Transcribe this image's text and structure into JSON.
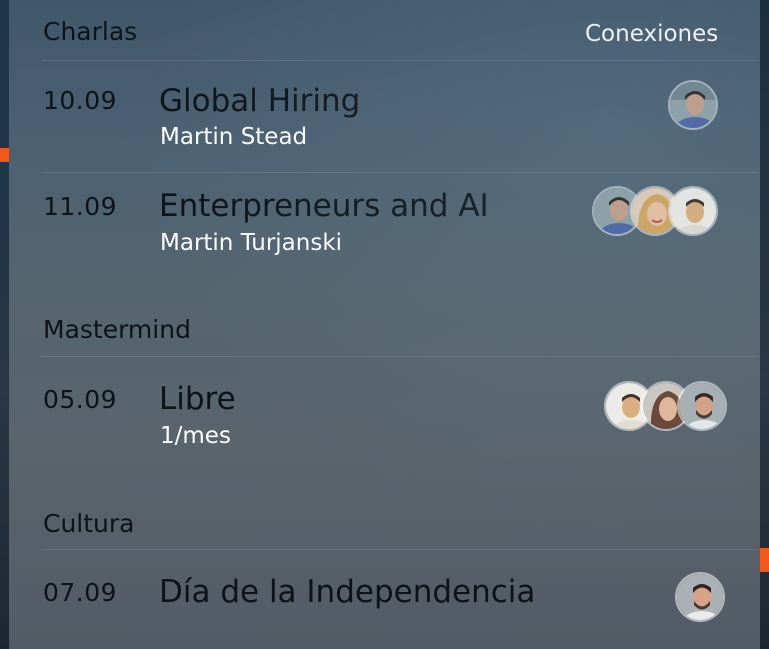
{
  "header": {
    "title": "Charlas",
    "connections_label": "Conexiones"
  },
  "sections": [
    {
      "name": "Charlas",
      "events": [
        {
          "date": "10.09",
          "title": "Global Hiring",
          "subtitle": "Martin Stead",
          "avatars": [
            "man-dark-hair",
            "",
            ""
          ]
        },
        {
          "date": "11.09",
          "title": "Enterpreneurs and AI",
          "subtitle": "Martin Turjanski",
          "avatars": [
            "man-dark-hair",
            "woman-blonde",
            "man-light"
          ]
        }
      ]
    },
    {
      "name": "Mastermind",
      "events": [
        {
          "date": "05.09",
          "title": "Libre",
          "subtitle": "1/mes",
          "avatars": [
            "man-light",
            "woman-brown-hair",
            "man-beard"
          ]
        }
      ]
    },
    {
      "name": "Cultura",
      "events": [
        {
          "date": "07.09",
          "title": "Día de la Independencia",
          "subtitle": "",
          "avatars": [
            "man-beard"
          ]
        }
      ]
    }
  ],
  "colors": {
    "accent": "#f25a1d",
    "dark_text": "#0d1318",
    "light_text": "#ffffff"
  }
}
